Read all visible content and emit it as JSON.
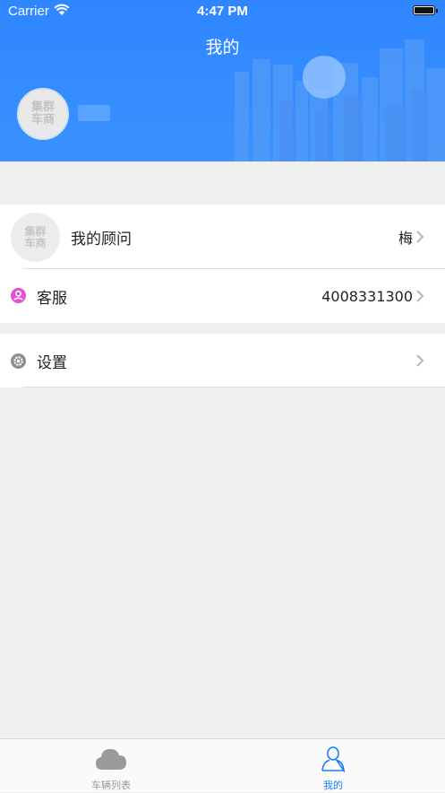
{
  "status_bar": {
    "carrier": "Carrier",
    "time": "4:47 PM"
  },
  "header": {
    "title": "我的",
    "avatar_text_line1": "集群",
    "avatar_text_line2": "车商",
    "background_color": "#3a8cff"
  },
  "advisor_row": {
    "avatar_text_line1": "集群",
    "avatar_text_line2": "车商",
    "label": "我的顾问",
    "value": "梅"
  },
  "service_row": {
    "icon": "customer-service-icon",
    "icon_color": "#e84fd2",
    "label": "客服",
    "value": "4008331300"
  },
  "settings_row": {
    "icon": "gear-icon",
    "icon_color": "#8e8e8e",
    "label": "设置"
  },
  "tab_bar": {
    "tabs": [
      {
        "label": "车辆列表",
        "icon": "cloud-icon",
        "active": false,
        "color": "#9a9a9a"
      },
      {
        "label": "我的",
        "icon": "person-icon",
        "active": true,
        "color": "#1a7cf0"
      }
    ]
  }
}
